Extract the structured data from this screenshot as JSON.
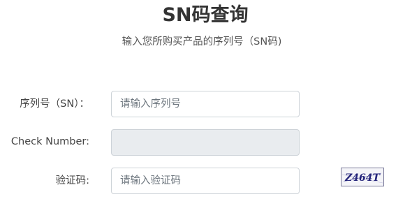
{
  "header": {
    "title": "SN码查询",
    "subtitle": "输入您所购买产品的序列号（SN码)"
  },
  "form": {
    "sn_label": "序列号（SN）：",
    "sn_placeholder": "请输入序列号",
    "sn_value": "",
    "check_label": "Check Number:",
    "check_value": "",
    "code_label": "验证码:",
    "code_placeholder": "请输入验证码",
    "code_value": ""
  },
  "captcha": {
    "text": "Z464T",
    "text_color": "#23237a",
    "background": "#f4f4f8",
    "border_color": "#7a7a9a"
  }
}
